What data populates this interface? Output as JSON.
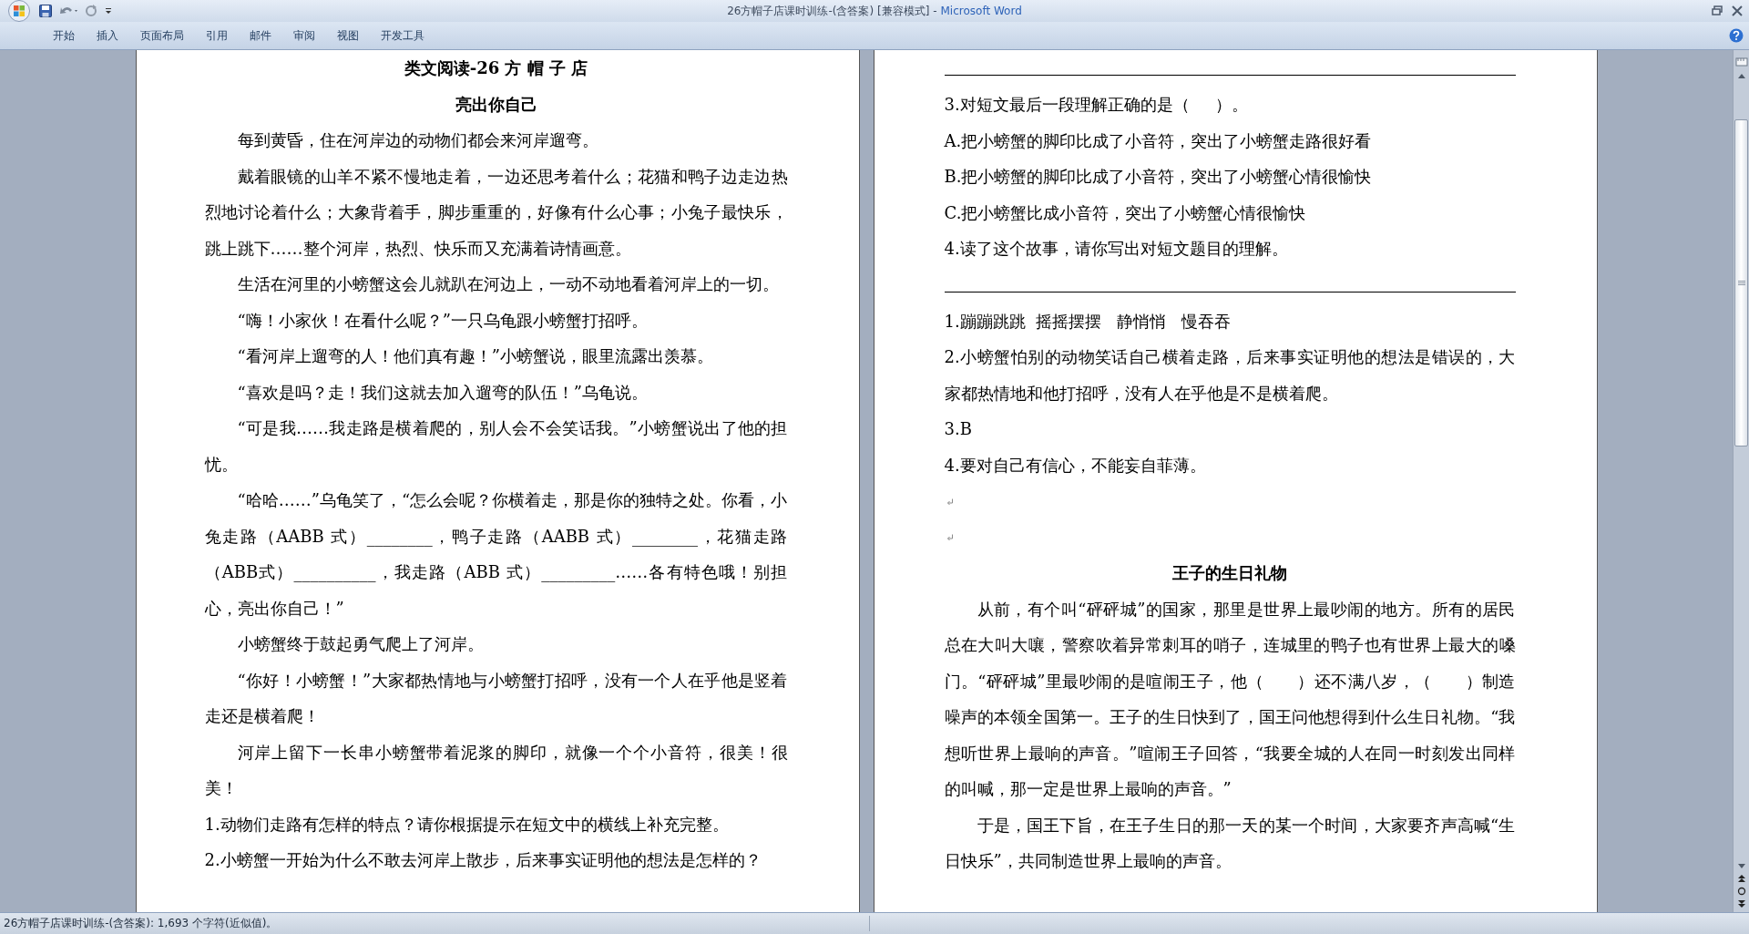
{
  "window": {
    "title_document": "26方帽子店课时训练-(含答案) [兼容模式] -",
    "title_app": "Microsoft Word"
  },
  "ribbon_tabs": [
    {
      "label": "开始"
    },
    {
      "label": "插入"
    },
    {
      "label": "页面布局"
    },
    {
      "label": "引用"
    },
    {
      "label": "邮件"
    },
    {
      "label": "审阅"
    },
    {
      "label": "视图"
    },
    {
      "label": "开发工具"
    }
  ],
  "pages": [
    {
      "blocks": [
        {
          "kind": "title",
          "text": "类文阅读-26 方 帽 子 店"
        },
        {
          "kind": "heading",
          "text": "亮出你自己"
        },
        {
          "kind": "para",
          "text": "每到黄昏，住在河岸边的动物们都会来河岸遛弯。"
        },
        {
          "kind": "para",
          "text": "戴着眼镜的山羊不紧不慢地走着，一边还思考着什么；花猫和鸭子边走边热烈地讨论着什么；大象背着手，脚步重重的，好像有什么心事；小兔子最快乐，跳上跳下……整个河岸，热烈、快乐而又充满着诗情画意。"
        },
        {
          "kind": "para",
          "text": "生活在河里的小螃蟹这会儿就趴在河边上，一动不动地看着河岸上的一切。"
        },
        {
          "kind": "para",
          "text": "“嗨！小家伙！在看什么呢？”一只乌龟跟小螃蟹打招呼。"
        },
        {
          "kind": "para",
          "text": "“看河岸上遛弯的人！他们真有趣！”小螃蟹说，眼里流露出羡慕。"
        },
        {
          "kind": "para",
          "text": "“喜欢是吗？走！我们这就去加入遛弯的队伍！”乌龟说。"
        },
        {
          "kind": "para",
          "text": "“可是我……我走路是横着爬的，别人会不会笑话我。”小螃蟹说出了他的担忧。"
        },
        {
          "kind": "para",
          "text": "“哈哈……”乌龟笑了，“怎么会呢？你横着走，那是你的独特之处。你看，小兔走路（AABB 式）________，鸭子走路（AABB 式）________，花猫走路（ABB式）__________，我走路（ABB 式）_________……各有特色哦！别担心，亮出你自己！”"
        },
        {
          "kind": "para",
          "text": "小螃蟹终于鼓起勇气爬上了河岸。"
        },
        {
          "kind": "para",
          "text": "“你好！小螃蟹！”大家都热情地与小螃蟹打招呼，没有一个人在乎他是竖着走还是横着爬！"
        },
        {
          "kind": "para",
          "text": "河岸上留下一长串小螃蟹带着泥浆的脚印，就像一个个小音符，很美！很美！"
        },
        {
          "kind": "item",
          "text": "1.动物们走路有怎样的特点？请你根据提示在短文中的横线上补充完整。"
        },
        {
          "kind": "item",
          "text": "2.小螃蟹一开始为什么不敢去河岸上散步，后来事实证明他的想法是怎样的？"
        }
      ]
    },
    {
      "blocks": [
        {
          "kind": "rule"
        },
        {
          "kind": "item",
          "text": "3.对短文最后一段理解正确的是（     ）。"
        },
        {
          "kind": "item",
          "text": "A.把小螃蟹的脚印比成了小音符，突出了小螃蟹走路很好看"
        },
        {
          "kind": "item",
          "text": "B.把小螃蟹的脚印比成了小音符，突出了小螃蟹心情很愉快"
        },
        {
          "kind": "item",
          "text": "C.把小螃蟹比成小音符，突出了小螃蟹心情很愉快"
        },
        {
          "kind": "item",
          "text": "4.读了这个故事，请你写出对短文题目的理解。"
        },
        {
          "kind": "rule"
        },
        {
          "kind": "item",
          "text": "1.蹦蹦跳跳  摇摇摆摆   静悄悄   慢吞吞"
        },
        {
          "kind": "item",
          "text": "2.小螃蟹怕别的动物笑话自己横着走路，后来事实证明他的想法是错误的，大家都热情地和他打招呼，没有人在乎他是不是横着爬。"
        },
        {
          "kind": "item",
          "text": "3.B    "
        },
        {
          "kind": "item",
          "text": "4.要对自己有信心，不能妄自菲薄。"
        },
        {
          "kind": "empty"
        },
        {
          "kind": "empty"
        },
        {
          "kind": "heading",
          "text": "王子的生日礼物"
        },
        {
          "kind": "para",
          "text": "从前，有个叫“砰砰城”的国家，那里是世界上最吵闹的地方。所有的居民总在大叫大嚷，警察吹着异常刺耳的哨子，连城里的鸭子也有世界上最大的嗓门。“砰砰城”里最吵闹的是喧闹王子，他（　　）还不满八岁，（　　）制造噪声的本领全国第一。王子的生日快到了，国王问他想得到什么生日礼物。“我想听世界上最响的声音。”喧闹王子回答，“我要全城的人在同一时刻发出同样的叫喊，那一定是世界上最响的声音。”"
        },
        {
          "kind": "para",
          "text": "于是，国王下旨，在王子生日的那一天的某一个时间，大家要齐声高喊“生日快乐”，共同制造世界上最响的声音。"
        }
      ]
    }
  ],
  "status_bar": {
    "text": "26方帽子店课时训练-(含答案): 1,693 个字符(近似值)。"
  }
}
